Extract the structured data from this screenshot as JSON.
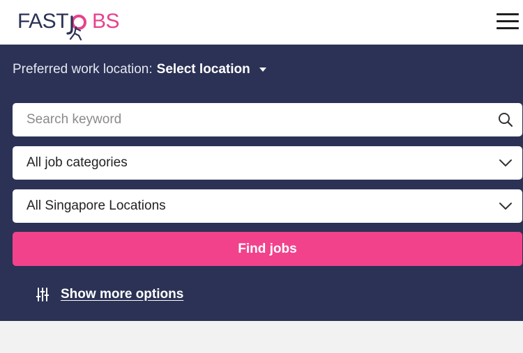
{
  "header": {
    "logo_text_dark": "FAST",
    "logo_text_pink": "BS",
    "menu_icon": "hamburger-menu-icon",
    "brand_colors": {
      "navy": "#2b3255",
      "pink": "#e8418d"
    }
  },
  "search_panel": {
    "preferred_label": "Preferred work location:",
    "preferred_value": "Select location",
    "keyword_placeholder": "Search keyword",
    "keyword_value": "",
    "category_selected": "All job categories",
    "location_selected": "All Singapore Locations",
    "find_button": "Find jobs",
    "more_options": "Show more options",
    "icons": {
      "search": "search-icon",
      "dropdown": "chevron-down-icon",
      "caret": "caret-down-icon",
      "filters": "filter-sliders-icon"
    },
    "colors": {
      "panel_bg": "#2b3255",
      "button_bg": "#f2428c"
    }
  }
}
